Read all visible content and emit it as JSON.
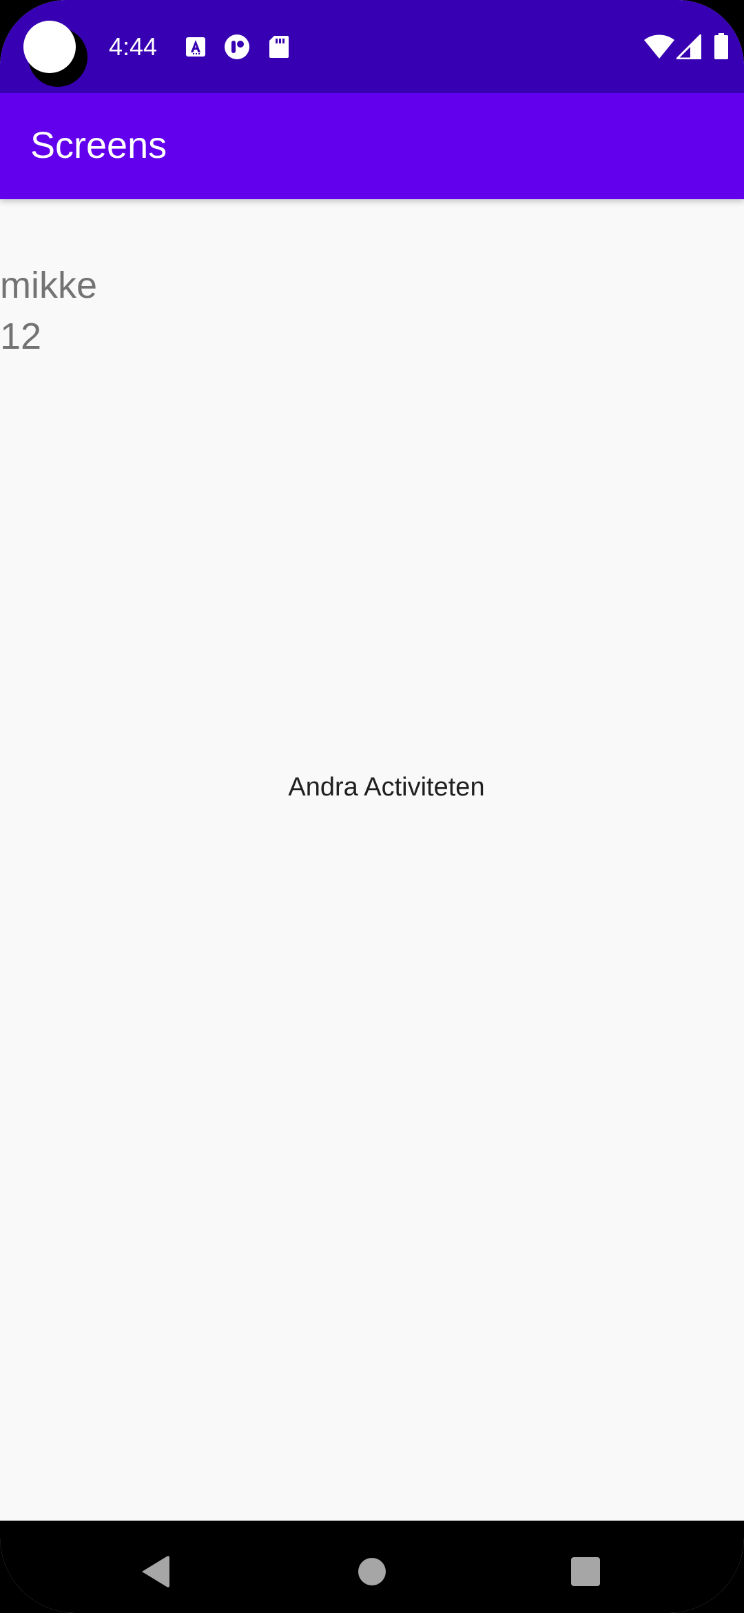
{
  "status_bar": {
    "time": "4:44",
    "icons_left": [
      "text-a-icon",
      "record-icon",
      "sd-card-icon"
    ],
    "icons_right": [
      "wifi-icon",
      "signal-icon",
      "battery-icon"
    ],
    "background": "#3700b3"
  },
  "app_bar": {
    "title": "Screens",
    "background": "#6200ee"
  },
  "content": {
    "name": "mikke",
    "number": "12",
    "center_label": "Andra Activiteten"
  },
  "nav_bar": {
    "buttons": [
      "back-icon",
      "home-icon",
      "recents-icon"
    ]
  }
}
